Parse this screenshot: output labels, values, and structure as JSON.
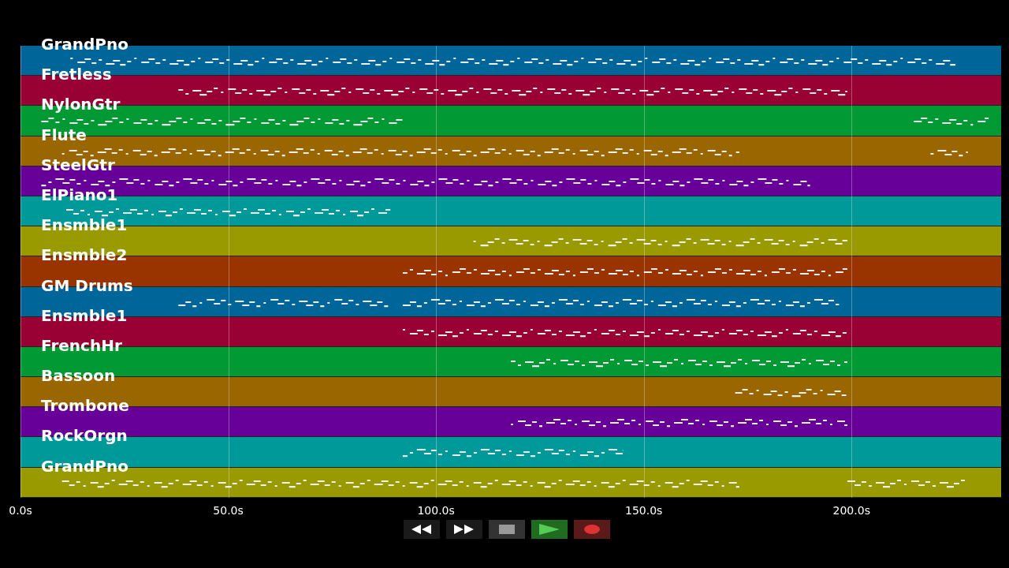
{
  "tracks": [
    {
      "name": "GrandPno",
      "color": "#00669a"
    },
    {
      "name": "Fretless",
      "color": "#990033"
    },
    {
      "name": "NylonGtr",
      "color": "#009933"
    },
    {
      "name": "Flute",
      "color": "#996600"
    },
    {
      "name": "SteelGtr",
      "color": "#660099"
    },
    {
      "name": "ElPiano1",
      "color": "#009999"
    },
    {
      "name": "Ensmble1",
      "color": "#999900"
    },
    {
      "name": "Ensmble2",
      "color": "#993300"
    },
    {
      "name": "GM Drums",
      "color": "#00669a"
    },
    {
      "name": "Ensmble1",
      "color": "#990033"
    },
    {
      "name": "FrenchHr",
      "color": "#009933"
    },
    {
      "name": "Bassoon",
      "color": "#996600"
    },
    {
      "name": "Trombone",
      "color": "#660099"
    },
    {
      "name": "RockOrgn",
      "color": "#009999"
    },
    {
      "name": "GrandPno",
      "color": "#999900"
    }
  ],
  "time_axis": [
    "0.0s",
    "50.0s",
    "100.0s",
    "150.0s",
    "200.0s"
  ],
  "transport": [
    {
      "kind": "rewind"
    },
    {
      "kind": "fast-forward"
    },
    {
      "kind": "stop"
    },
    {
      "kind": "play"
    },
    {
      "kind": "record"
    }
  ]
}
